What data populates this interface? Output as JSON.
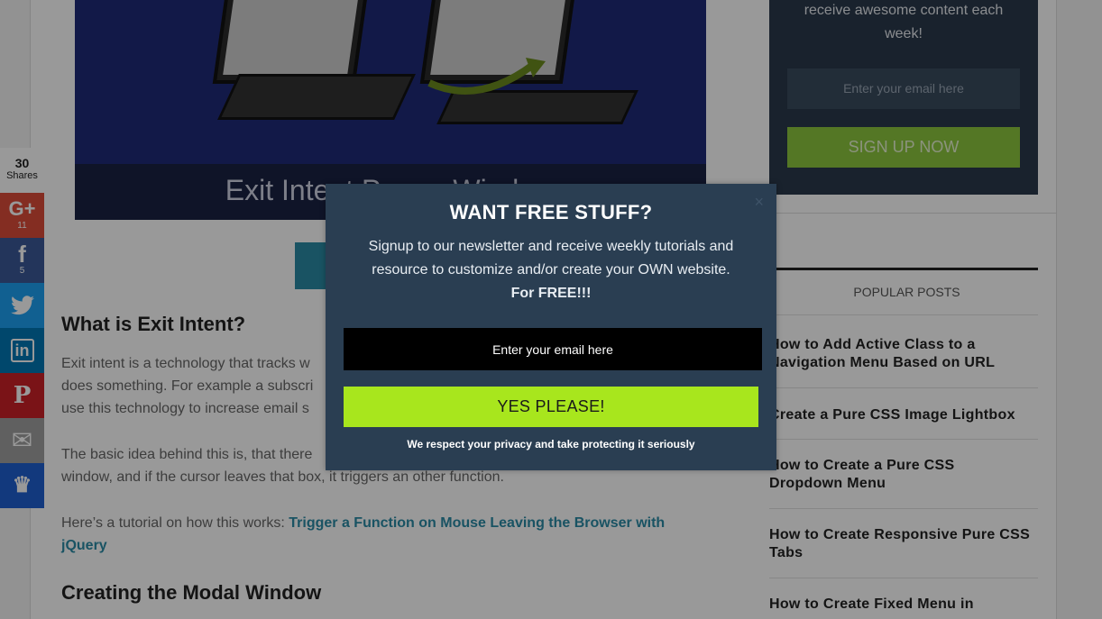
{
  "hero": {
    "caption": "Exit Intent Popup Window"
  },
  "article": {
    "heading1": "What is Exit Intent?",
    "para1_line1": "Exit intent is a technology that tracks w",
    "para1_line2": "does something. For example a subscri",
    "para1_line3": "use this technology to increase email s",
    "para2_line1": "The basic idea behind this is, that there",
    "para2_line2": "window, and if the cursor leaves that box, it triggers an other function.",
    "para3_text": "Here’s a tutorial on how this works: ",
    "para3_link": "Trigger a Function on Mouse Leaving the Browser with jQuery",
    "heading2": "Creating the Modal Window"
  },
  "sidebar": {
    "signup_text": "receive awesome content each week!",
    "signup_placeholder": "Enter your email here",
    "signup_button": "SIGN UP NOW",
    "popular_title": "POPULAR POSTS",
    "posts": [
      "How to Add Active Class to a Navigation Menu Based on URL",
      "Create a Pure CSS Image Lightbox",
      "How to Create a Pure CSS Dropdown Menu",
      "How to Create Responsive Pure CSS Tabs",
      "How to Create Fixed Menu in"
    ]
  },
  "share": {
    "count": "30",
    "count_label": "Shares",
    "buttons": [
      {
        "name": "google-plus",
        "glyph": "G+",
        "count": "11",
        "color": "#dd4b39"
      },
      {
        "name": "facebook",
        "glyph": "f",
        "count": "5",
        "color": "#3b5998"
      },
      {
        "name": "twitter",
        "glyph": "🐦",
        "count": "",
        "color": "#1da1f2"
      },
      {
        "name": "linkedin",
        "glyph": "in",
        "count": "",
        "color": "#0077b5"
      },
      {
        "name": "pinterest",
        "glyph": "P",
        "count": "",
        "color": "#cb2027"
      },
      {
        "name": "email",
        "glyph": "✉",
        "count": "",
        "color": "#a0a0a0"
      },
      {
        "name": "sumome",
        "glyph": "♛",
        "count": "",
        "color": "#1f5fd1"
      }
    ]
  },
  "modal": {
    "close": "×",
    "title": "WANT FREE STUFF?",
    "body_line1": "Signup to our newsletter and receive weekly tutorials and",
    "body_line2": "resource to customize and/or create your OWN website.",
    "body_free": "For FREE!!!",
    "email_placeholder": "Enter your email here",
    "button": "YES PLEASE!",
    "note": "We respect your privacy and take protecting it seriously"
  }
}
